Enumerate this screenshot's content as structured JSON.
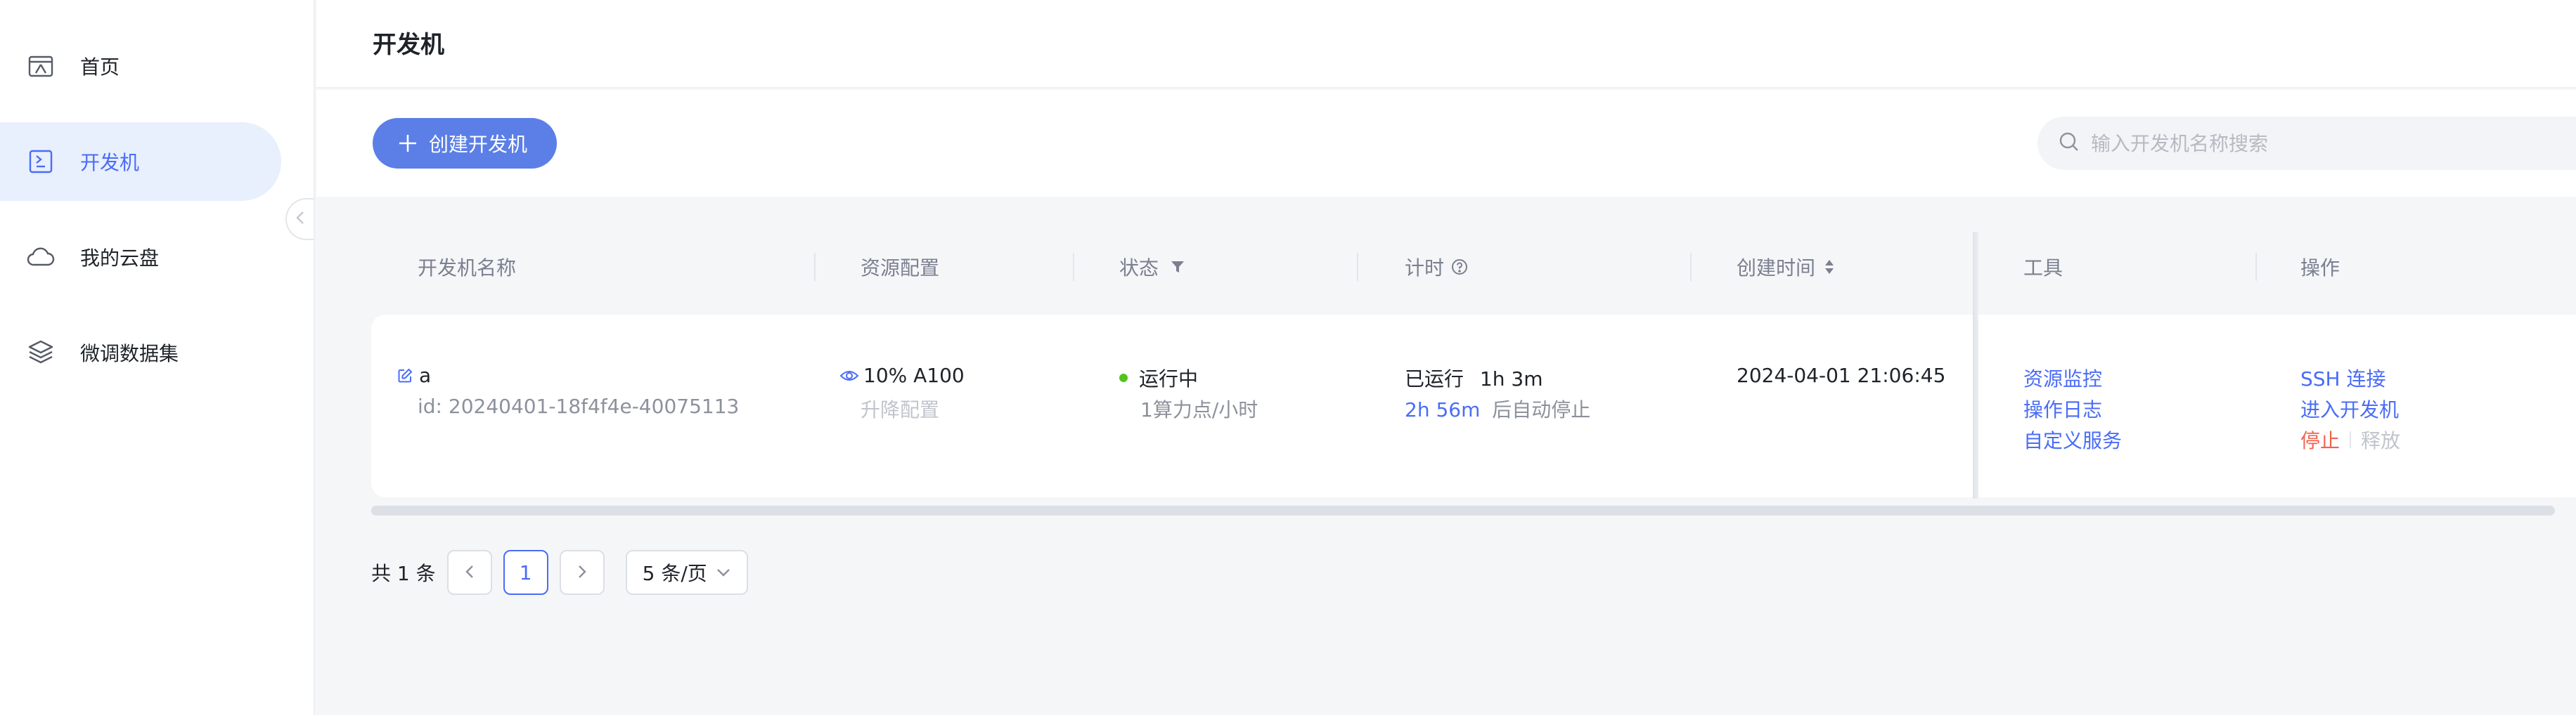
{
  "sidebar": {
    "items": [
      {
        "label": "首页",
        "icon": "home-icon",
        "active": false
      },
      {
        "label": "开发机",
        "icon": "terminal-icon",
        "active": true
      },
      {
        "label": "我的云盘",
        "icon": "cloud-icon",
        "active": false
      },
      {
        "label": "微调数据集",
        "icon": "layers-icon",
        "active": false
      }
    ]
  },
  "header": {
    "title": "开发机"
  },
  "toolbar": {
    "create_label": "创建开发机",
    "search_placeholder": "输入开发机名称搜索"
  },
  "table": {
    "columns": {
      "name": "开发机名称",
      "resource": "资源配置",
      "status": "状态",
      "timer": "计时",
      "created": "创建时间",
      "tools": "工具",
      "actions": "操作"
    },
    "rows": [
      {
        "name": "a",
        "id": "id: 20240401-18f4f4e-40075113",
        "resource": "10% A100",
        "resource_action": "升降配置",
        "status": "运行中",
        "status_detail": "1算力点/小时",
        "runtime_prefix": "已运行",
        "runtime": "1h 3m",
        "auto_stop_time": "2h 56m",
        "auto_stop_suffix": "后自动停止",
        "created": "2024-04-01 21:06:45",
        "tools": [
          "资源监控",
          "操作日志",
          "自定义服务"
        ],
        "actions": {
          "ssh": "SSH 连接",
          "enter": "进入开发机",
          "stop": "停止",
          "release": "释放"
        }
      }
    ]
  },
  "pagination": {
    "total_label": "共 1 条",
    "current_page": "1",
    "page_size": "5 条/页"
  },
  "colors": {
    "accent": "#4a6cf7",
    "primary_button": "#5b7fe6",
    "running": "#52c41a",
    "danger": "#f0624d"
  }
}
